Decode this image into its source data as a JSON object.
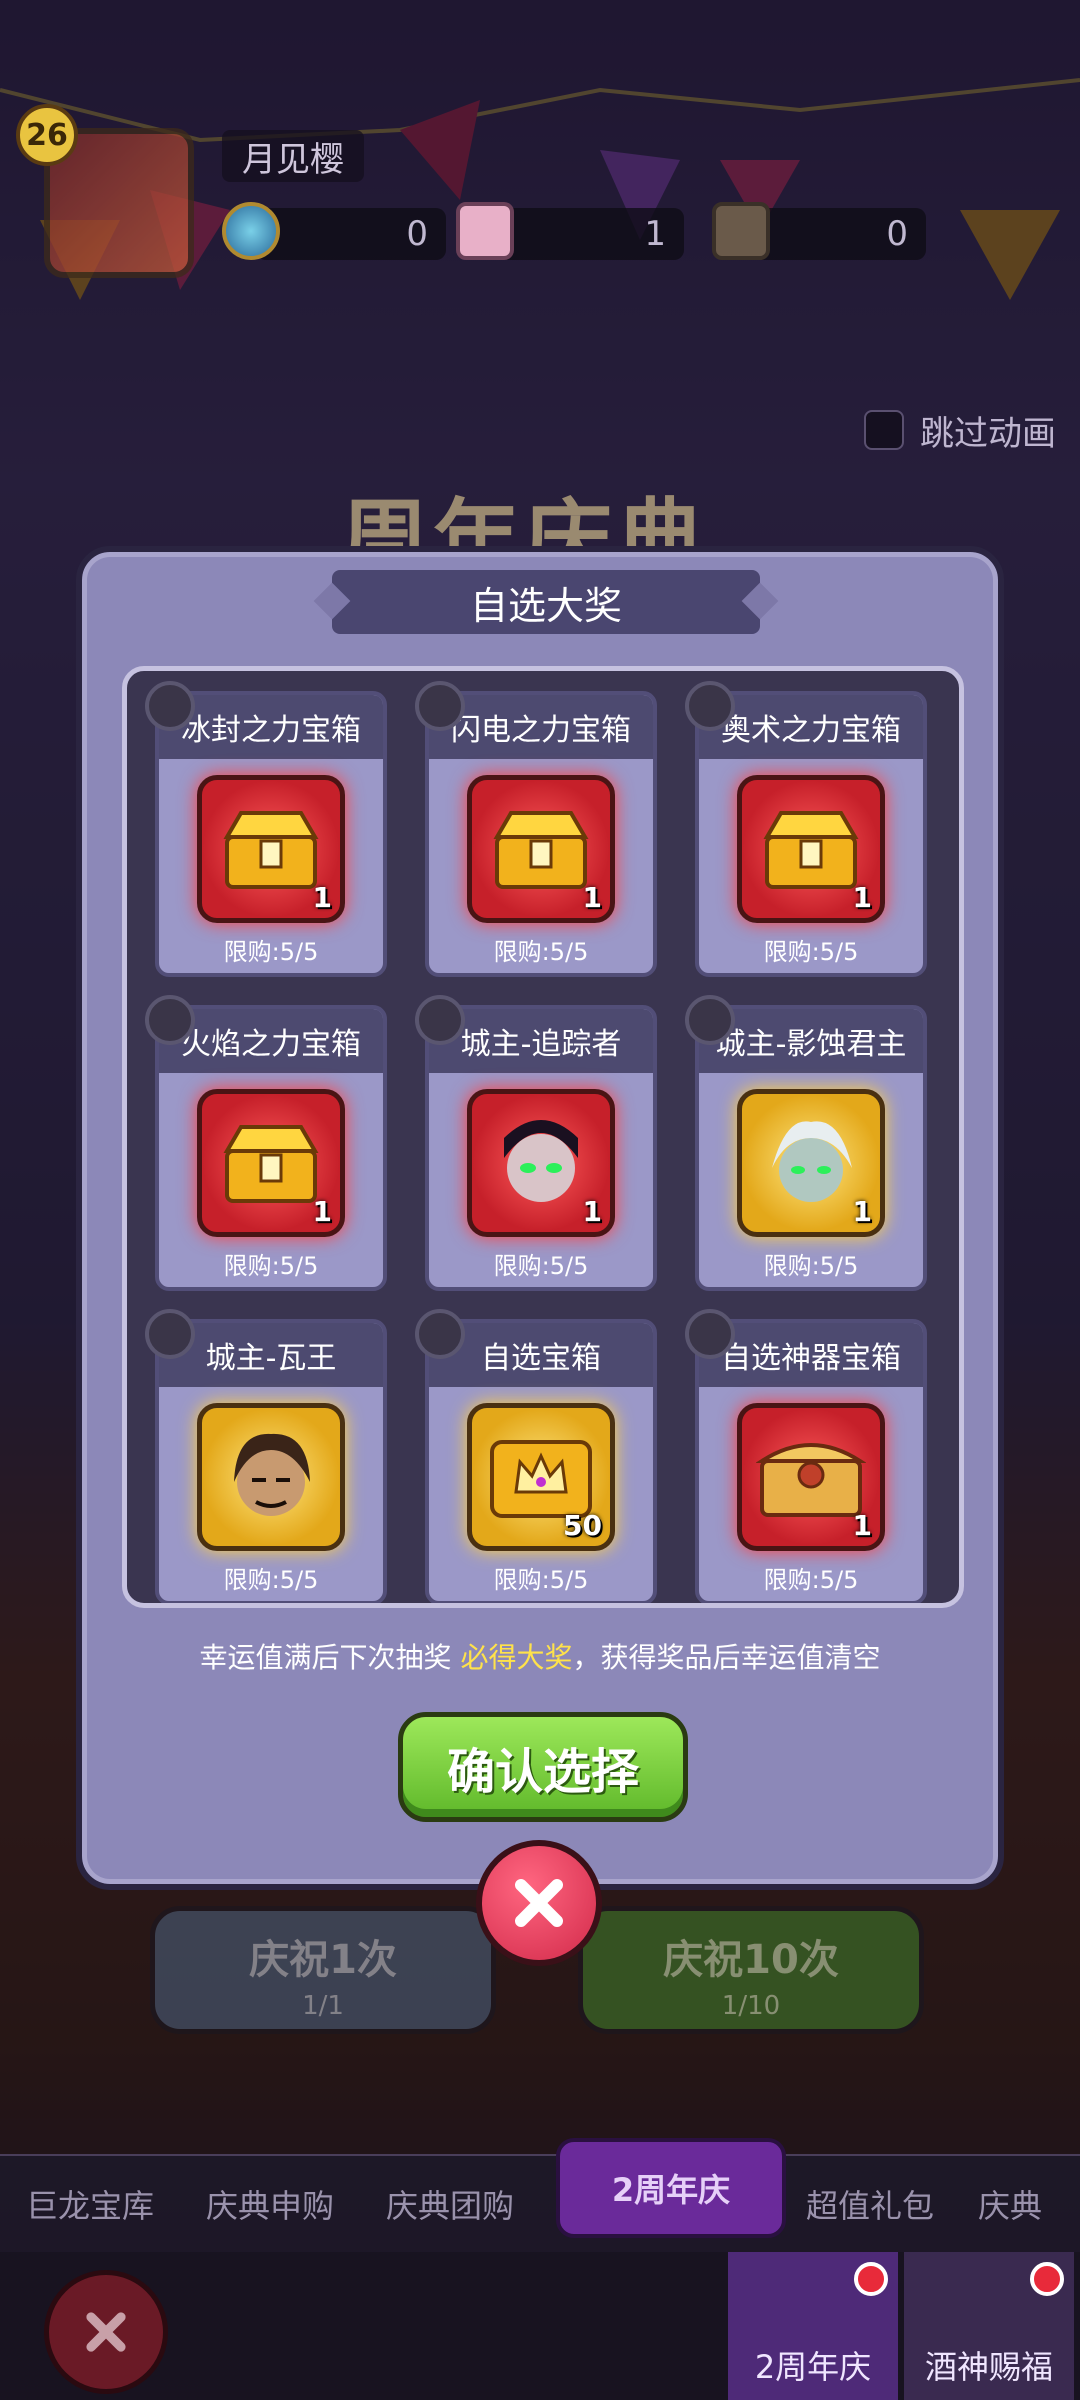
{
  "player": {
    "level": "26",
    "name": "月见樱"
  },
  "resources": [
    {
      "name": "coin",
      "value": "0",
      "icon": "gem-coin-icon"
    },
    {
      "name": "ticket",
      "value": "1",
      "icon": "ticket-icon"
    },
    {
      "name": "tag",
      "value": "0",
      "icon": "tag-icon"
    }
  ],
  "skip": {
    "label": "跳过动画"
  },
  "background_title": "周年庆典",
  "modal": {
    "title": "自选大奖",
    "items": [
      {
        "name": "冰封之力宝箱",
        "qty": "1",
        "limit": "限购:5/5",
        "frame": "red",
        "icon": "treasure-chest-icon"
      },
      {
        "name": "闪电之力宝箱",
        "qty": "1",
        "limit": "限购:5/5",
        "frame": "red",
        "icon": "treasure-chest-icon"
      },
      {
        "name": "奥术之力宝箱",
        "qty": "1",
        "limit": "限购:5/5",
        "frame": "red",
        "icon": "treasure-chest-icon"
      },
      {
        "name": "火焰之力宝箱",
        "qty": "1",
        "limit": "限购:5/5",
        "frame": "red",
        "icon": "treasure-chest-icon"
      },
      {
        "name": "城主-追踪者",
        "qty": "1",
        "limit": "限购:5/5",
        "frame": "red",
        "icon": "hero-portrait-icon"
      },
      {
        "name": "城主-影蚀君主",
        "qty": "1",
        "limit": "限购:5/5",
        "frame": "gold",
        "icon": "hero-portrait-icon"
      },
      {
        "name": "城主-瓦王",
        "qty": "",
        "limit": "限购:5/5",
        "frame": "gold",
        "icon": "hero-portrait-icon"
      },
      {
        "name": "自选宝箱",
        "qty": "50",
        "limit": "限购:5/5",
        "frame": "gold",
        "icon": "crown-chest-icon"
      },
      {
        "name": "自选神器宝箱",
        "qty": "1",
        "limit": "限购:5/5",
        "frame": "red",
        "icon": "artifact-chest-icon"
      }
    ],
    "lucky_prefix": "幸运值满后下次抽奖 ",
    "lucky_highlight": "必得大奖",
    "lucky_suffix": "，获得奖品后幸运值清空",
    "confirm_label": "确认选择"
  },
  "celebrate": [
    {
      "label": "庆祝1次",
      "count": "1/1"
    },
    {
      "label": "庆祝10次",
      "count": "1/10"
    }
  ],
  "tabs": [
    "巨龙宝库",
    "庆典申购",
    "庆典团购",
    "2周年庆",
    "超值礼包",
    "庆典"
  ],
  "features": [
    {
      "label": "2周年庆"
    },
    {
      "label": "酒神赐福"
    }
  ],
  "colors": {
    "modal_bg": "#8c88b8",
    "confirm_green": "#7ed444",
    "close_red": "#e03a5a",
    "highlight_yellow": "#ffe24a"
  }
}
